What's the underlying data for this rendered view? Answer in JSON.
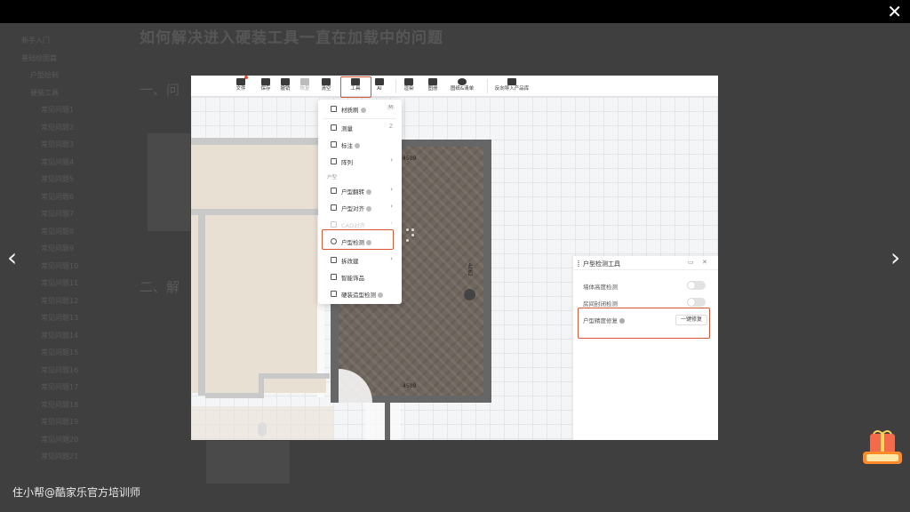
{
  "viewer": {
    "close_label": "✕",
    "prev_label": "‹",
    "next_label": "›",
    "watermark": "住小帮@酷家乐官方培训师"
  },
  "background": {
    "title": "如何解决进入硬装工具一直在加载中的问题",
    "section_one": "一、问",
    "section_two": "二、解",
    "nav_items": [
      "新手入门",
      "基础绘图篇",
      "户型绘制",
      "硬装工具",
      "常见问题1",
      "常见问题2",
      "常见问题3",
      "常见问题4",
      "常见问题5",
      "常见问题6",
      "常见问题7",
      "常见问题8",
      "常见问题9",
      "常见问题10",
      "常见问题11",
      "常见问题12",
      "常见问题13",
      "常见问题14",
      "常见问题15",
      "常见问题16",
      "常见问题17",
      "常见问题18",
      "常见问题19",
      "常见问题20",
      "常见问题21"
    ]
  },
  "toolbar": {
    "items": [
      {
        "label": "文件",
        "icon": "home-icon"
      },
      {
        "label": "保存",
        "icon": "save-icon"
      },
      {
        "label": "撤销",
        "icon": "undo-icon"
      },
      {
        "label": "恢复",
        "icon": "redo-icon"
      },
      {
        "label": "清空",
        "icon": "eraser-icon"
      },
      {
        "label": "工具",
        "icon": "wrench-icon"
      },
      {
        "label": "AI",
        "icon": "ai-icon"
      },
      {
        "label": "渲染",
        "icon": "camera-icon"
      },
      {
        "label": "图册",
        "icon": "image-icon"
      },
      {
        "label": "图纸&清单",
        "icon": "drawing-icon"
      },
      {
        "label": "反向导入产品库",
        "icon": "import-icon"
      }
    ]
  },
  "tools_menu": {
    "items": [
      {
        "label": "材质刷",
        "key": "M",
        "arrow": ""
      },
      {
        "label": "测量",
        "key": "Z",
        "arrow": ""
      },
      {
        "label": "标注",
        "key": "",
        "arrow": ""
      },
      {
        "label": "阵列",
        "key": "",
        "arrow": "›"
      }
    ],
    "section_label": "户型",
    "items2": [
      {
        "label": "户型翻转",
        "arrow": "›"
      },
      {
        "label": "户型对齐",
        "arrow": "›"
      },
      {
        "label": "CAD对齐",
        "arrow": "›"
      },
      {
        "label": "户型检测",
        "arrow": ""
      },
      {
        "label": "拆改建",
        "arrow": "›"
      },
      {
        "label": "智能饰品",
        "arrow": ""
      },
      {
        "label": "硬装造型检测",
        "arrow": ""
      }
    ]
  },
  "plan": {
    "dim_top": "4509",
    "dim_right": "4062",
    "dim_bottom": "4509"
  },
  "detect_panel": {
    "title": "户型检测工具",
    "rows": [
      {
        "label": "墙体高度检测"
      },
      {
        "label": "房间封闭检测"
      }
    ],
    "precision_label": "户型精度修复",
    "fix_button": "一键修复"
  },
  "colors": {
    "highlight": "#d9542f",
    "floor": "#6f665e",
    "room_beige": "#e9e0d4"
  }
}
